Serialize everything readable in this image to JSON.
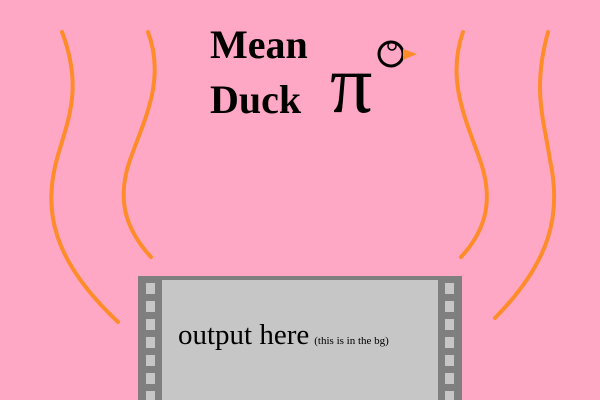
{
  "title": {
    "line1": "Mean",
    "line2": "Duck",
    "pi_symbol": "π"
  },
  "output": {
    "main_label": "output here",
    "note": "(this is in the bg)"
  },
  "colors": {
    "background": "#ffa8c5",
    "steam": "#ff8c2a",
    "panel_fill": "#c6c6c6",
    "panel_border": "#7f7f7f",
    "duck_beak": "#ff8c2a",
    "text": "#000000"
  },
  "icons": {
    "steam": "steam-lines-icon",
    "duck": "duck-head-icon",
    "film_strip": "film-strip-border-icon"
  }
}
